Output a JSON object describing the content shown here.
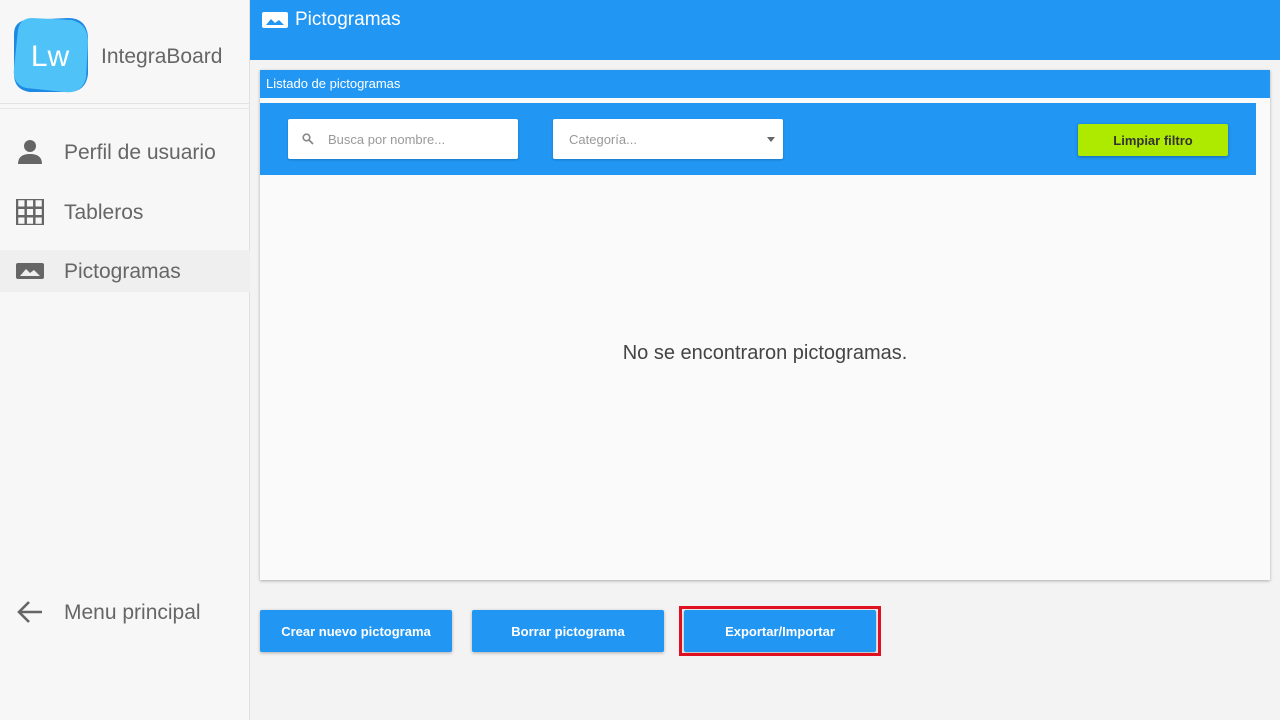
{
  "app": {
    "logo_text": "Lw",
    "name": "IntegraBoard"
  },
  "sidebar": {
    "items": [
      {
        "label": "Perfil de usuario",
        "icon": "person-icon"
      },
      {
        "label": "Tableros",
        "icon": "grid-icon"
      },
      {
        "label": "Pictogramas",
        "icon": "image-icon",
        "active": true
      }
    ],
    "back": {
      "label": "Menu principal",
      "icon": "arrow-left-icon"
    }
  },
  "header": {
    "title": "Pictogramas",
    "icon": "image-icon"
  },
  "card": {
    "title": "Listado de pictogramas",
    "search_placeholder": "Busca por nombre...",
    "category_placeholder": "Categoría...",
    "clear_label": "Limpiar filtro",
    "empty_message": "No se encontraron pictogramas."
  },
  "actions": {
    "create_label": "Crear nuevo pictograma",
    "delete_label": "Borrar pictograma",
    "export_label": "Exportar/Importar"
  },
  "colors": {
    "primary": "#2196f3",
    "accent": "#aeea00",
    "highlight": "#e01020"
  }
}
